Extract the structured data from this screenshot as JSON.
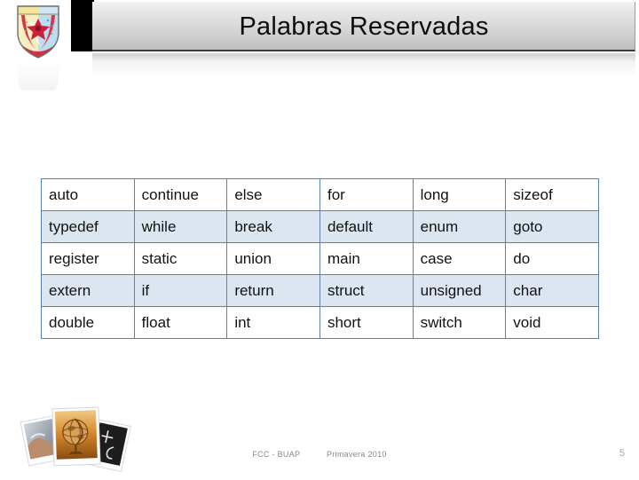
{
  "slide": {
    "title": "Palabras Reservadas",
    "page_number": "5",
    "background_color": "#ffffff"
  },
  "header": {
    "accent_bar_color": "#000000",
    "plate_gradient_top": "#f2f2f2",
    "plate_gradient_bottom": "#bdbdbd",
    "title_color": "#0d0d0d",
    "logo_name": "buap-crest-logo"
  },
  "table": {
    "name": "reserved-words-table",
    "border_color": "#5b82ad",
    "stripe_color": "#dce6f1",
    "columns": 6,
    "rows": [
      [
        "auto",
        "continue",
        "else",
        "for",
        "long",
        "sizeof"
      ],
      [
        "typedef",
        "while",
        "break",
        "default",
        "enum",
        "goto"
      ],
      [
        "register",
        "static",
        "union",
        "main",
        "case",
        "do"
      ],
      [
        "extern",
        "if",
        "return",
        "struct",
        "unsigned",
        "char"
      ],
      [
        "double",
        "float",
        "int",
        "short",
        "switch",
        "void"
      ]
    ]
  },
  "footer": {
    "left": "FCC - BUAP",
    "right": "Primavera 2010",
    "text_color": "#8a8a8a",
    "art_name": "photo-collage-globe-blackboard"
  }
}
